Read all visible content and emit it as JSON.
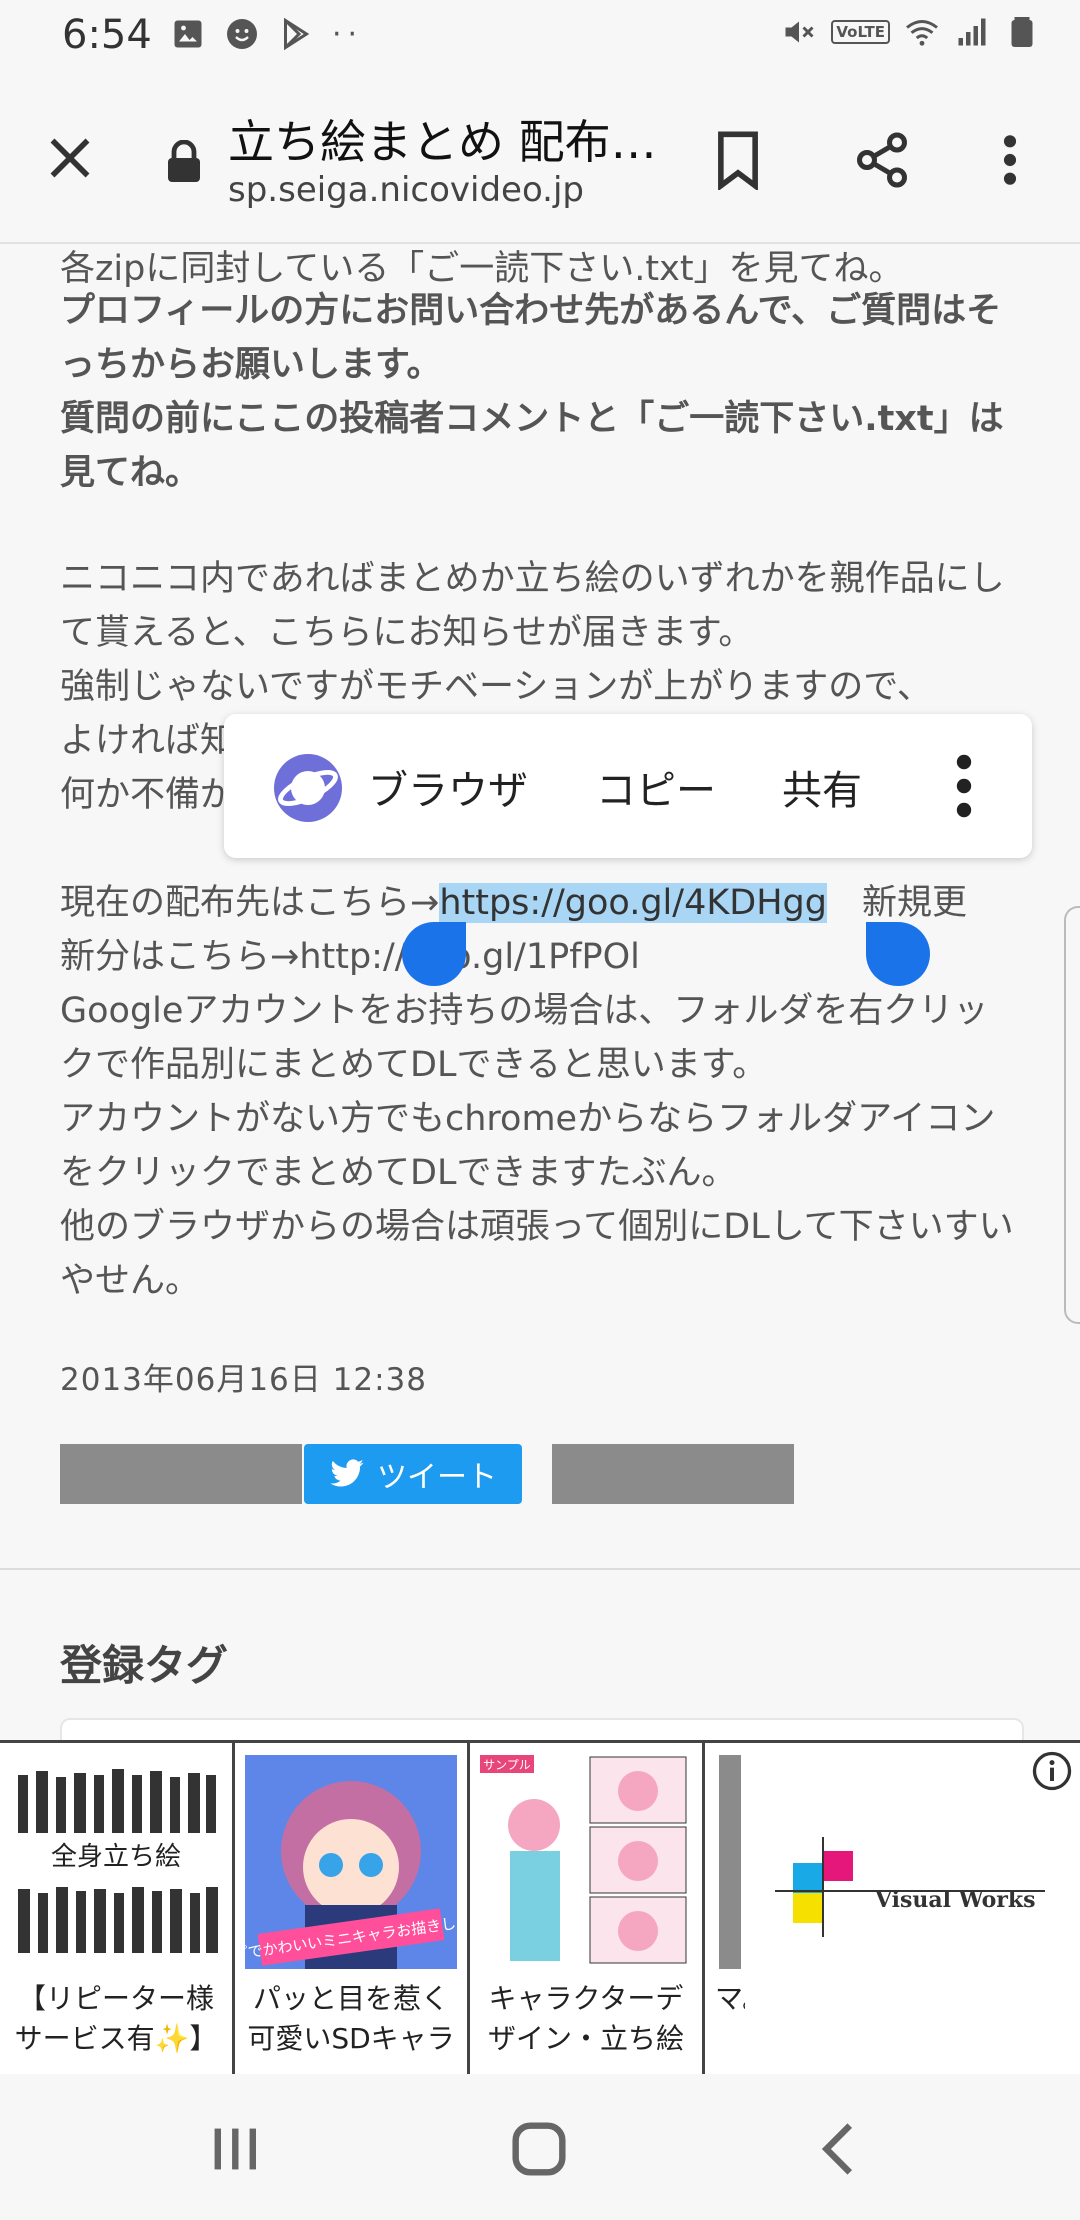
{
  "status": {
    "time": "6:54",
    "volte": "VoLTE"
  },
  "toolbar": {
    "title": "立ち絵まとめ 配布…",
    "url": "sp.seiga.nicovideo.jp"
  },
  "content": {
    "line_top": "各zipに同封している「ご一読下さい.txt」を見てね。",
    "bold1": "プロフィールの方にお問い合わせ先があるんで、ご質問はそっちからお願いします。",
    "bold2": "質問の前にここの投稿者コメントと「ご一読下さい.txt」は見てね。",
    "p2_l1": "ニコニコ内であればまとめか立ち絵のいずれかを親作品にして貰えると、こちらにお知らせが届きます。",
    "p2_l2": "強制じゃないですがモチベーションが上がりますので、",
    "p2_l3": "よければ知",
    "p2_l4": "何か不備が",
    "dist_prefix": "現在の配布先はこちら→",
    "dist_link": "https://goo.gl/4KDHgg",
    "dist_suffix": "　新規更",
    "line_new": "新分はこちら→http://goo.gl/1PfPOl",
    "p3": "Googleアカウントをお持ちの場合は、フォルダを右クリックで作品別にまとめてDLできると思います。",
    "p4": "アカウントがない方でもchromeからならフォルダアイコンをクリックでまとめてDLできますたぶん。",
    "p5": "他のブラウザからの場合は頑張って個別にDLして下さいすいやせん。",
    "date": "2013年06月16日 12:38",
    "tweet_label": "ツイート",
    "tags_heading": "登録タグ"
  },
  "popup": {
    "browser": "ブラウザ",
    "copy": "コピー",
    "share": "共有"
  },
  "ads": [
    {
      "image_text": "全身立ち絵",
      "caption": "【リピーター様サービス有✨】"
    },
    {
      "image_text": "ポップでかわいいミニキャラお描きします★",
      "caption": "パッと目を惹く可愛いSDキャラを"
    },
    {
      "image_text": "サンプル",
      "caption": "キャラクターデザイン・立ち絵イラ"
    },
    {
      "image_text": "",
      "caption": "マ。"
    },
    {
      "image_text": "Visual Works",
      "caption": ""
    }
  ],
  "colors": {
    "accent": "#1a73e8",
    "selection": "#a9d6f5",
    "twitter": "#1d9bf0"
  }
}
